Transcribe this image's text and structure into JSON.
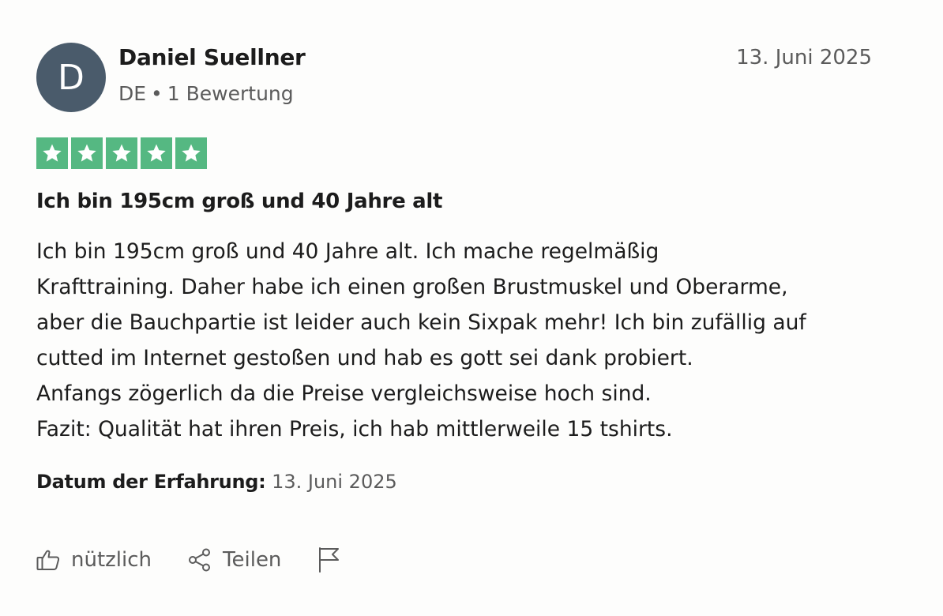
{
  "reviewer": {
    "initial": "D",
    "name": "Daniel Suellner",
    "country": "DE",
    "separator": "•",
    "review_count": "1 Bewertung"
  },
  "review": {
    "date": "13. Juni 2025",
    "rating": 5,
    "rating_max": 5,
    "title": "Ich bin 195cm groß und 40 Jahre alt",
    "body_lines": [
      "Ich bin 195cm groß und 40 Jahre alt. Ich mache regelmäßig",
      "Krafttraining. Daher habe ich einen großen Brustmuskel und Oberarme,",
      "aber die Bauchpartie ist leider auch kein Sixpak mehr! Ich bin zufällig auf",
      "cutted im Internet gestoßen und hab es gott sei dank probiert.",
      "Anfangs zögerlich da die Preise vergleichsweise hoch sind.",
      "Fazit: Qualität hat ihren Preis, ich hab mittlerweile 15 tshirts."
    ],
    "experience_label": "Datum der Erfahrung:",
    "experience_date": "13. Juni 2025"
  },
  "actions": {
    "useful_label": "nützlich",
    "share_label": "Teilen",
    "icons": {
      "useful": "thumbs-up-icon",
      "share": "share-icon",
      "report": "flag-icon"
    }
  },
  "colors": {
    "avatar_bg": "#4a5b6b",
    "star_bg": "#55b882",
    "text_primary": "#1c1c1c",
    "text_secondary": "#5b5b5b"
  }
}
